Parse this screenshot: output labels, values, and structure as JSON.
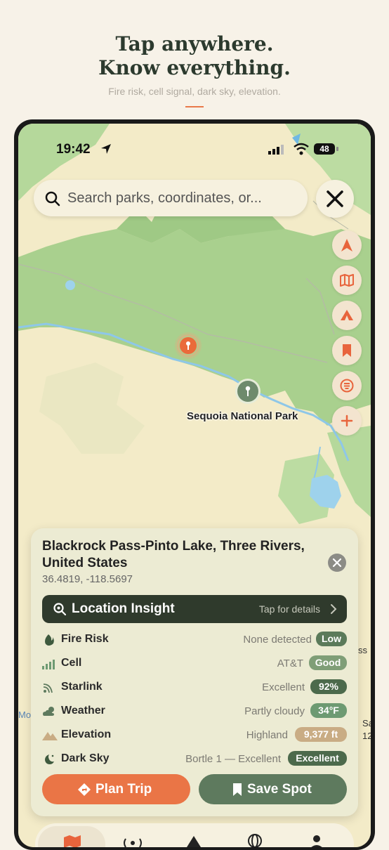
{
  "hero": {
    "title_line1": "Tap anywhere.",
    "title_line2": "Know everything.",
    "subtitle": "Fire risk, cell signal, dark sky, elevation.",
    "accent_color": "#e8794a"
  },
  "status_bar": {
    "time": "19:42",
    "battery": "48",
    "icons": [
      "location-arrow-icon",
      "signal-bars-icon",
      "wifi-icon",
      "battery-icon"
    ]
  },
  "search": {
    "placeholder": "Search parks, coordinates, or..."
  },
  "map_controls": [
    "navigation-arrow-icon",
    "map-icon",
    "tent-icon",
    "bookmark-icon",
    "layers-icon",
    "plus-icon"
  ],
  "map": {
    "park_label": "Sequoia National Park",
    "edge_labels": [
      "ss",
      "Sa",
      "12",
      "Mo"
    ]
  },
  "location_card": {
    "name": "Blackrock Pass-Pinto Lake, Three Rivers, United States",
    "coordinates": "36.4819, -118.5697",
    "insight": {
      "title": "Location Insight",
      "hint": "Tap for details"
    },
    "rows": [
      {
        "icon": "flame-icon",
        "label": "Fire Risk",
        "value": "None detected",
        "badge": "Low",
        "badge_color": "#5b7a5a"
      },
      {
        "icon": "cell-signal-icon",
        "label": "Cell",
        "value": "AT&T",
        "badge": "Good",
        "badge_color": "#7f9e77"
      },
      {
        "icon": "satellite-icon",
        "label": "Starlink",
        "value": "Excellent",
        "badge": "92%",
        "badge_color": "#4c6a4c"
      },
      {
        "icon": "partly-cloudy-icon",
        "label": "Weather",
        "value": "Partly cloudy",
        "badge": "34°F",
        "badge_color": "#6d9a72"
      },
      {
        "icon": "mountain-icon",
        "label": "Elevation",
        "value": "Highland",
        "badge": "9,377 ft",
        "badge_color": "#c9ac84"
      },
      {
        "icon": "moon-stars-icon",
        "label": "Dark Sky",
        "value": "Bortle 1 — Excellent",
        "badge": "Excellent",
        "badge_color": "#4c6a4c"
      }
    ],
    "plan_button": "Plan Trip",
    "save_button": "Save Spot"
  },
  "colors": {
    "primary_orange": "#ea7546",
    "primary_green": "#5e7a5e",
    "dark_green": "#2f3a2c",
    "forest": "#a9d08e",
    "water": "#9ed2ec"
  }
}
